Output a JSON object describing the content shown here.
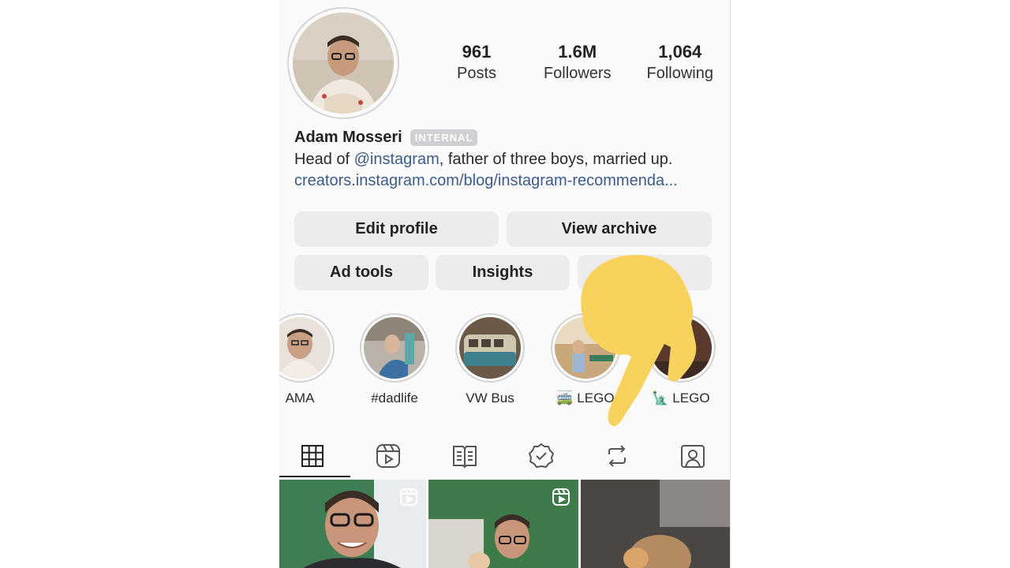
{
  "profile": {
    "stats": [
      {
        "value": "961",
        "label": "Posts"
      },
      {
        "value": "1.6M",
        "label": "Followers"
      },
      {
        "value": "1,064",
        "label": "Following"
      }
    ],
    "name": "Adam Mosseri",
    "badge": "INTERNAL",
    "bio_prefix": "Head of ",
    "bio_mention": "@instagram",
    "bio_suffix": ", father of three boys, married up.",
    "link": "creators.instagram.com/blog/instagram-recommenda..."
  },
  "buttons": {
    "edit_profile": "Edit profile",
    "view_archive": "View archive",
    "ad_tools": "Ad tools",
    "insights": "Insights"
  },
  "highlights": [
    {
      "label": "AMA"
    },
    {
      "label": "#dadlife"
    },
    {
      "label": "VW Bus"
    },
    {
      "label": "🚎 LEGO"
    },
    {
      "label": "🗽 LEGO"
    }
  ],
  "tabs": [
    "grid-icon",
    "reels-icon",
    "guides-icon",
    "badge-check-icon",
    "reposts-icon",
    "tagged-icon"
  ],
  "colors": {
    "accent_link": "#3b5b8a",
    "annotation_yellow": "#f7d35e"
  }
}
